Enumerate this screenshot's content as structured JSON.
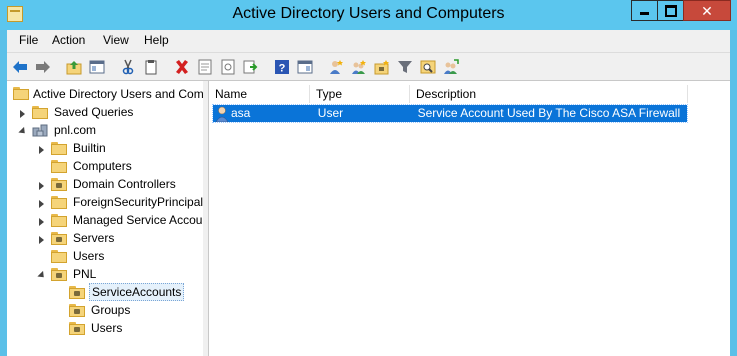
{
  "window": {
    "title": "Active Directory Users and Computers"
  },
  "menu": [
    "File",
    "Action",
    "View",
    "Help"
  ],
  "toolbar": {
    "buttons": [
      "back-icon",
      "forward-icon",
      "up-folder-icon",
      "show-tree-icon",
      "cut-icon",
      "paste-icon",
      "delete-icon",
      "properties-icon",
      "refresh-icon",
      "export-icon",
      "help-icon",
      "show-pane-icon",
      "new-user-icon",
      "new-group-icon",
      "new-ou-icon",
      "filter-icon",
      "find-icon",
      "add-to-group-icon"
    ]
  },
  "tree": {
    "root": "Active Directory Users and Com",
    "saved_queries": "Saved Queries",
    "domain": "pnl.com",
    "items": [
      "Builtin",
      "Computers",
      "Domain Controllers",
      "ForeignSecurityPrincipals",
      "Managed Service Accour",
      "Servers",
      "Users"
    ],
    "pnl": "PNL",
    "pnl_children": [
      "ServiceAccounts",
      "Groups",
      "Users"
    ]
  },
  "list": {
    "columns": [
      "Name",
      "Type",
      "Description"
    ],
    "rows": [
      {
        "name": "asa",
        "type": "User",
        "description": "Service Account Used By The Cisco ASA Firewall"
      }
    ]
  }
}
